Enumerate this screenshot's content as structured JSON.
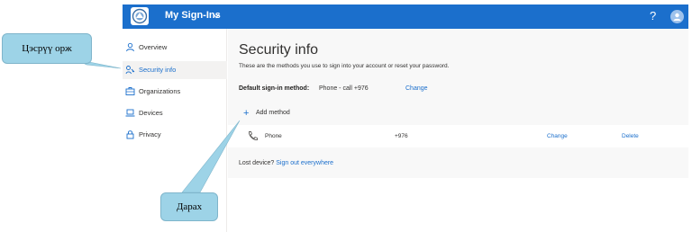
{
  "header": {
    "app_title": "My Sign-Ins",
    "help_label": "?"
  },
  "sidebar": {
    "items": [
      {
        "label": "Overview",
        "icon": "person-icon",
        "active": false
      },
      {
        "label": "Security info",
        "icon": "security-key-icon",
        "active": true
      },
      {
        "label": "Organizations",
        "icon": "briefcase-icon",
        "active": false
      },
      {
        "label": "Devices",
        "icon": "laptop-icon",
        "active": false
      },
      {
        "label": "Privacy",
        "icon": "lock-icon",
        "active": false
      }
    ]
  },
  "main": {
    "title": "Security info",
    "description": "These are the methods you use to sign into your account or reset your password.",
    "default_method": {
      "label": "Default sign-in method:",
      "value": "Phone - call +976",
      "change_label": "Change"
    },
    "add_method_label": "Add method",
    "methods": [
      {
        "type": "Phone",
        "value": "+976",
        "change_label": "Change",
        "delete_label": "Delete"
      }
    ],
    "lost_device_text": "Lost device?",
    "sign_out_link": "Sign out everywhere"
  },
  "annotations": {
    "callout_1": "Цэсрүү орж",
    "callout_2": "Дарах"
  },
  "colors": {
    "header_blue": "#1b6fcc",
    "link_blue": "#1b6fcc",
    "callout_fill": "#9dd3e7"
  }
}
